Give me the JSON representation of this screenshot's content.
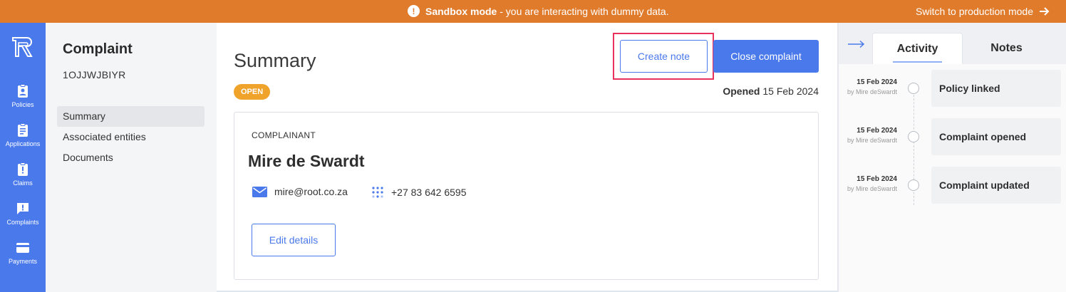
{
  "banner": {
    "mode_label": "Sandbox mode",
    "message": " - you are interacting with dummy data.",
    "switch_label": "Switch to production mode"
  },
  "rail": {
    "items": [
      {
        "label": "Policies",
        "icon": "policies-icon"
      },
      {
        "label": "Applications",
        "icon": "applications-icon"
      },
      {
        "label": "Claims",
        "icon": "claims-icon"
      },
      {
        "label": "Complaints",
        "icon": "complaints-icon"
      },
      {
        "label": "Payments",
        "icon": "payments-icon"
      }
    ]
  },
  "subnav": {
    "title": "Complaint",
    "id": "1OJJWJBIYR",
    "items": [
      "Summary",
      "Associated entities",
      "Documents"
    ],
    "active": "Summary"
  },
  "main": {
    "title": "Summary",
    "status": "OPEN",
    "create_note_label": "Create note",
    "close_label": "Close complaint",
    "opened_label": "Opened",
    "opened_date": "15 Feb 2024",
    "complainant": {
      "section_label": "COMPLAINANT",
      "name": "Mire de Swardt",
      "email": "mire@root.co.za",
      "phone": "+27 83 642 6595",
      "edit_label": "Edit details"
    }
  },
  "side": {
    "tabs": [
      "Activity",
      "Notes"
    ],
    "active_tab": "Activity",
    "activity": [
      {
        "date": "15 Feb 2024",
        "by": "by Mire deSwardt",
        "title": "Policy linked"
      },
      {
        "date": "15 Feb 2024",
        "by": "by Mire deSwardt",
        "title": "Complaint opened"
      },
      {
        "date": "15 Feb 2024",
        "by": "by Mire deSwardt",
        "title": "Complaint updated"
      }
    ]
  },
  "colors": {
    "banner": "#e07b2c",
    "accent": "#4a79ec",
    "status_open": "#f0a32b",
    "highlight": "#e8315b"
  }
}
